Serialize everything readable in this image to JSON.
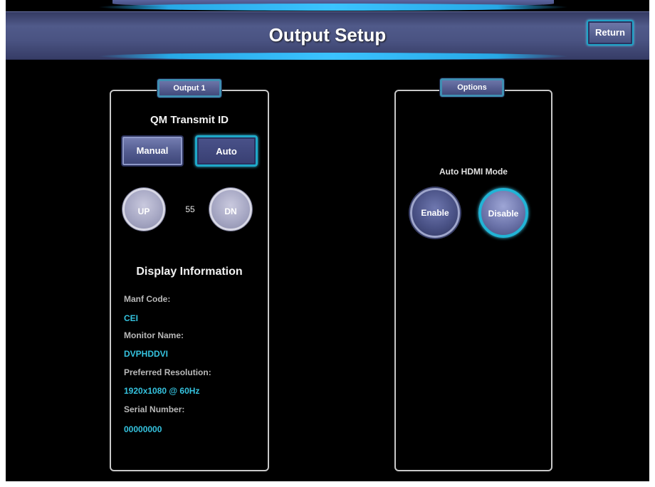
{
  "header": {
    "title": "Output Setup",
    "return_label": "Return"
  },
  "output_panel": {
    "tab_label": "Output 1",
    "qm_heading": "QM Transmit ID",
    "manual_label": "Manual",
    "auto_label": "Auto",
    "up_label": "UP",
    "dn_label": "DN",
    "transmit_id": "55",
    "display_heading": "Display Information",
    "info": [
      {
        "label": "Manf Code:",
        "value": "CEI"
      },
      {
        "label": "Monitor Name:",
        "value": "DVPHDDVI"
      },
      {
        "label": "Preferred Resolution:",
        "value": "1920x1080 @ 60Hz"
      },
      {
        "label": "Serial Number:",
        "value": "00000000"
      }
    ]
  },
  "options_panel": {
    "tab_label": "Options",
    "hdmi_heading": "Auto HDMI Mode",
    "enable_label": "Enable",
    "disable_label": "Disable"
  },
  "colors": {
    "accent": "#1ea8c8",
    "value_text": "#35c3df",
    "header": "#4a5382"
  }
}
